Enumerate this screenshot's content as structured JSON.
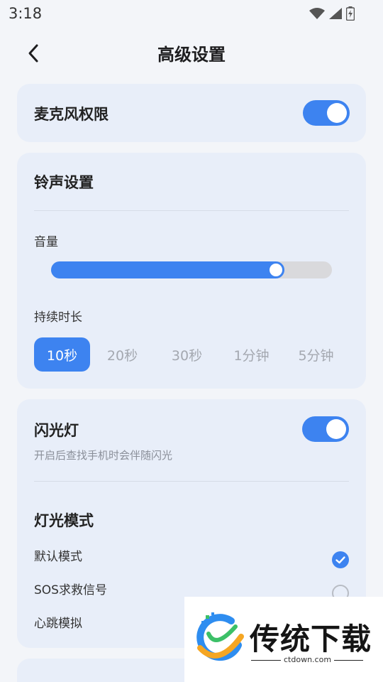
{
  "status_bar": {
    "time": "3:18",
    "icons": [
      "wifi-icon",
      "signal-icon",
      "battery-charging-icon"
    ]
  },
  "header": {
    "back_icon": "chevron-left-icon",
    "title": "高级设置"
  },
  "microphone": {
    "label": "麦克风权限",
    "enabled": true
  },
  "ringtone": {
    "title": "铃声设置",
    "volume_label": "音量",
    "volume_percent": 80,
    "duration_label": "持续时长",
    "duration_options": [
      "10秒",
      "20秒",
      "30秒",
      "1分钟",
      "5分钟"
    ],
    "selected_duration": "10秒"
  },
  "flashlight": {
    "label": "闪光灯",
    "description": "开启后查找手机时会伴随闪光",
    "enabled": true,
    "mode_title": "灯光模式",
    "modes": [
      {
        "label": "默认模式",
        "checked": true
      },
      {
        "label": "SOS求救信号",
        "checked": false
      },
      {
        "label": "心跳模拟",
        "checked": false
      }
    ]
  },
  "watermark": {
    "brand": "传统下载",
    "url": "ctdown.com"
  },
  "colors": {
    "accent": "#3d83f0",
    "card_bg": "#e8eef9",
    "page_bg": "#f3f5f9",
    "muted_text": "#a4a8b0"
  }
}
